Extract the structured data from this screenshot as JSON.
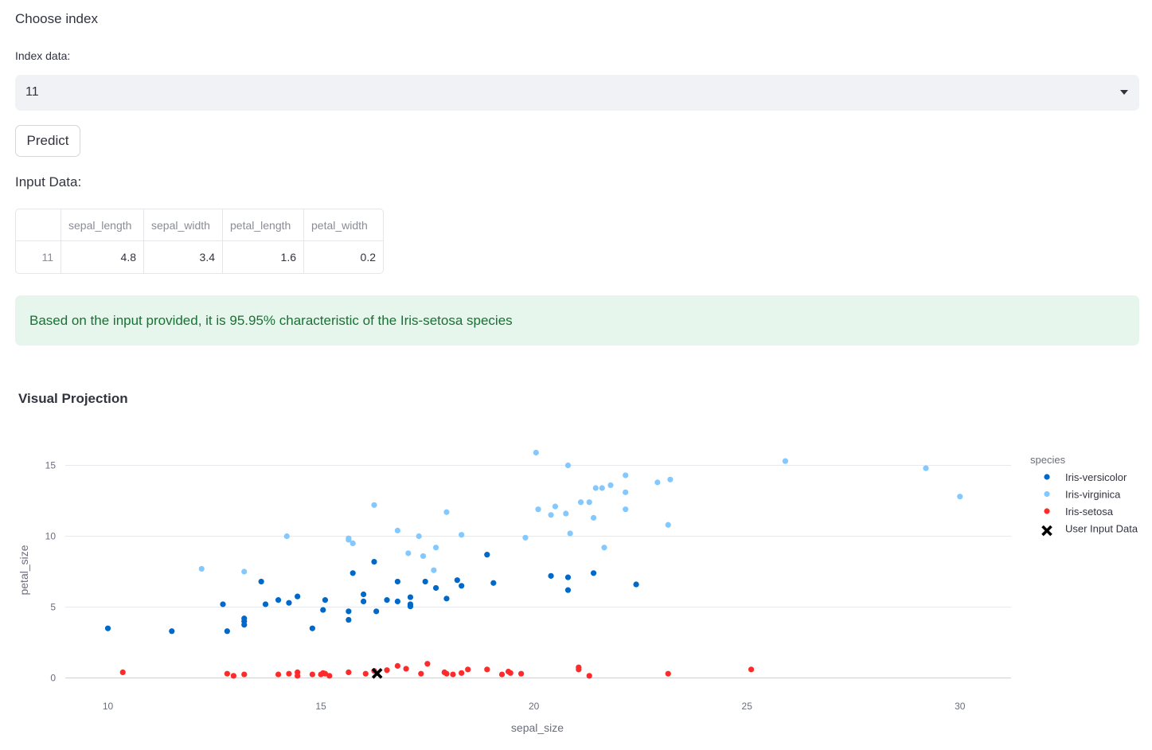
{
  "header": {
    "title": "Choose index"
  },
  "index_select": {
    "label": "Index data:",
    "value": "11"
  },
  "predict_button": {
    "label": "Predict"
  },
  "input_data": {
    "label": "Input Data:",
    "columns": [
      "",
      "sepal_length",
      "sepal_width",
      "petal_length",
      "petal_width"
    ],
    "rows": [
      [
        "11",
        "4.8",
        "3.4",
        "1.6",
        "0.2"
      ]
    ]
  },
  "result": {
    "message": "Based on the input provided, it is 95.95% characteristic of the Iris-setosa species"
  },
  "visual": {
    "title": "Visual Projection"
  },
  "colors": {
    "versicolor": "#0068c9",
    "virginica": "#83c9ff",
    "setosa": "#ff2b2b",
    "user": "#000000"
  },
  "chart_data": {
    "type": "scatter",
    "xlabel": "sepal_size",
    "ylabel": "petal_size",
    "xlim": [
      9,
      31.2
    ],
    "ylim": [
      -1.6,
      17.5
    ],
    "xticks": [
      10,
      15,
      20,
      25,
      30
    ],
    "yticks": [
      0,
      5,
      10,
      15
    ],
    "grid": true,
    "legend": {
      "title": "species",
      "position": "right"
    },
    "series": [
      {
        "name": "Iris-versicolor",
        "marker": "circle",
        "color": "#0068c9",
        "points": [
          [
            10.0,
            3.5
          ],
          [
            11.5,
            3.3
          ],
          [
            12.7,
            5.2
          ],
          [
            12.8,
            3.3
          ],
          [
            13.2,
            4.2
          ],
          [
            13.2,
            4.0
          ],
          [
            13.2,
            3.75
          ],
          [
            13.6,
            6.8
          ],
          [
            13.7,
            5.2
          ],
          [
            14.0,
            5.5
          ],
          [
            14.25,
            5.3
          ],
          [
            14.45,
            5.75
          ],
          [
            14.8,
            3.5
          ],
          [
            15.05,
            4.8
          ],
          [
            15.1,
            5.5
          ],
          [
            15.65,
            4.7
          ],
          [
            15.65,
            4.1
          ],
          [
            15.75,
            7.4
          ],
          [
            16.0,
            5.9
          ],
          [
            16.0,
            5.4
          ],
          [
            16.25,
            8.2
          ],
          [
            16.3,
            4.7
          ],
          [
            16.55,
            5.5
          ],
          [
            16.8,
            6.8
          ],
          [
            16.8,
            5.4
          ],
          [
            17.1,
            5.7
          ],
          [
            17.1,
            5.2
          ],
          [
            17.1,
            5.05
          ],
          [
            17.45,
            6.8
          ],
          [
            17.7,
            6.35
          ],
          [
            17.95,
            5.6
          ],
          [
            18.2,
            6.9
          ],
          [
            18.3,
            6.5
          ],
          [
            18.9,
            8.7
          ],
          [
            19.05,
            6.7
          ],
          [
            20.4,
            7.2
          ],
          [
            20.8,
            7.1
          ],
          [
            20.8,
            6.2
          ],
          [
            21.4,
            7.4
          ],
          [
            22.4,
            6.6
          ]
        ]
      },
      {
        "name": "Iris-virginica",
        "marker": "circle",
        "color": "#83c9ff",
        "points": [
          [
            12.2,
            7.7
          ],
          [
            13.2,
            7.5
          ],
          [
            14.2,
            10.0
          ],
          [
            15.65,
            9.75
          ],
          [
            15.65,
            9.85
          ],
          [
            15.75,
            9.5
          ],
          [
            16.25,
            12.2
          ],
          [
            16.8,
            10.4
          ],
          [
            17.05,
            8.8
          ],
          [
            17.3,
            10.0
          ],
          [
            17.4,
            8.6
          ],
          [
            17.65,
            7.6
          ],
          [
            17.7,
            9.2
          ],
          [
            17.95,
            11.7
          ],
          [
            18.3,
            10.1
          ],
          [
            19.8,
            9.9
          ],
          [
            20.05,
            15.9
          ],
          [
            20.1,
            11.9
          ],
          [
            20.4,
            11.5
          ],
          [
            20.5,
            12.1
          ],
          [
            20.75,
            11.6
          ],
          [
            20.8,
            15.0
          ],
          [
            20.85,
            10.2
          ],
          [
            21.1,
            12.4
          ],
          [
            21.3,
            12.4
          ],
          [
            21.4,
            11.3
          ],
          [
            21.45,
            13.4
          ],
          [
            21.6,
            13.4
          ],
          [
            21.65,
            9.2
          ],
          [
            21.8,
            13.6
          ],
          [
            22.15,
            14.3
          ],
          [
            22.15,
            13.1
          ],
          [
            22.15,
            11.9
          ],
          [
            22.9,
            13.8
          ],
          [
            23.15,
            10.8
          ],
          [
            23.2,
            14.0
          ],
          [
            25.9,
            15.3
          ],
          [
            29.2,
            14.8
          ],
          [
            30.0,
            12.8
          ]
        ]
      },
      {
        "name": "Iris-setosa",
        "marker": "circle",
        "color": "#ff2b2b",
        "points": [
          [
            10.35,
            0.4
          ],
          [
            12.8,
            0.3
          ],
          [
            12.95,
            0.15
          ],
          [
            13.2,
            0.25
          ],
          [
            14.0,
            0.25
          ],
          [
            14.25,
            0.3
          ],
          [
            14.45,
            0.4
          ],
          [
            14.45,
            0.15
          ],
          [
            14.8,
            0.25
          ],
          [
            15.0,
            0.25
          ],
          [
            15.05,
            0.35
          ],
          [
            15.1,
            0.3
          ],
          [
            15.2,
            0.15
          ],
          [
            15.65,
            0.4
          ],
          [
            16.05,
            0.3
          ],
          [
            16.25,
            0.5
          ],
          [
            16.55,
            0.55
          ],
          [
            16.8,
            0.85
          ],
          [
            17.0,
            0.65
          ],
          [
            17.35,
            0.3
          ],
          [
            17.5,
            1.0
          ],
          [
            17.9,
            0.4
          ],
          [
            17.95,
            0.3
          ],
          [
            18.1,
            0.25
          ],
          [
            18.3,
            0.35
          ],
          [
            18.45,
            0.6
          ],
          [
            18.9,
            0.6
          ],
          [
            19.25,
            0.25
          ],
          [
            19.4,
            0.45
          ],
          [
            19.45,
            0.35
          ],
          [
            19.7,
            0.3
          ],
          [
            21.05,
            0.6
          ],
          [
            21.05,
            0.75
          ],
          [
            21.3,
            0.15
          ],
          [
            23.15,
            0.3
          ],
          [
            25.1,
            0.6
          ]
        ]
      },
      {
        "name": "User Input Data",
        "marker": "x",
        "color": "#000000",
        "points": [
          [
            16.32,
            0.32
          ]
        ]
      }
    ]
  }
}
